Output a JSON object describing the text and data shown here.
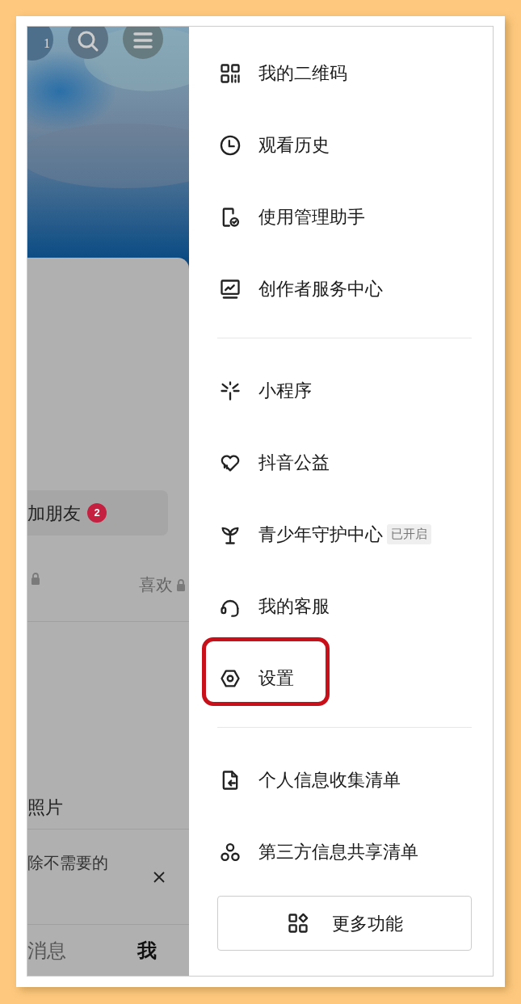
{
  "left_panel": {
    "header_count": "1",
    "add_friends": {
      "label": "加朋友",
      "badge": "2"
    },
    "tabs": [
      {
        "locked": true
      },
      {
        "label": "喜欢",
        "locked": true
      }
    ],
    "list": [
      {
        "text": "照片",
        "closable": false
      },
      {
        "text": "除不需要的",
        "closable": true
      }
    ],
    "bottom_nav": [
      {
        "label": "消息",
        "selected": false
      },
      {
        "label": "我",
        "selected": true
      }
    ]
  },
  "drawer": {
    "groups": [
      [
        {
          "label": "我的二维码",
          "highlighted": false
        },
        {
          "label": "观看历史",
          "highlighted": false
        },
        {
          "label": "使用管理助手",
          "highlighted": false
        },
        {
          "label": "创作者服务中心",
          "highlighted": false
        }
      ],
      [
        {
          "label": "小程序",
          "highlighted": false
        },
        {
          "label": "抖音公益",
          "highlighted": false
        },
        {
          "label": "青少年守护中心",
          "tag": "已开启",
          "highlighted": false
        },
        {
          "label": "我的客服",
          "highlighted": false
        },
        {
          "label": "设置",
          "highlighted": true
        }
      ],
      [
        {
          "label": "个人信息收集清单",
          "highlighted": false
        },
        {
          "label": "第三方信息共享清单",
          "highlighted": false
        }
      ]
    ],
    "more_button": "更多功能"
  }
}
